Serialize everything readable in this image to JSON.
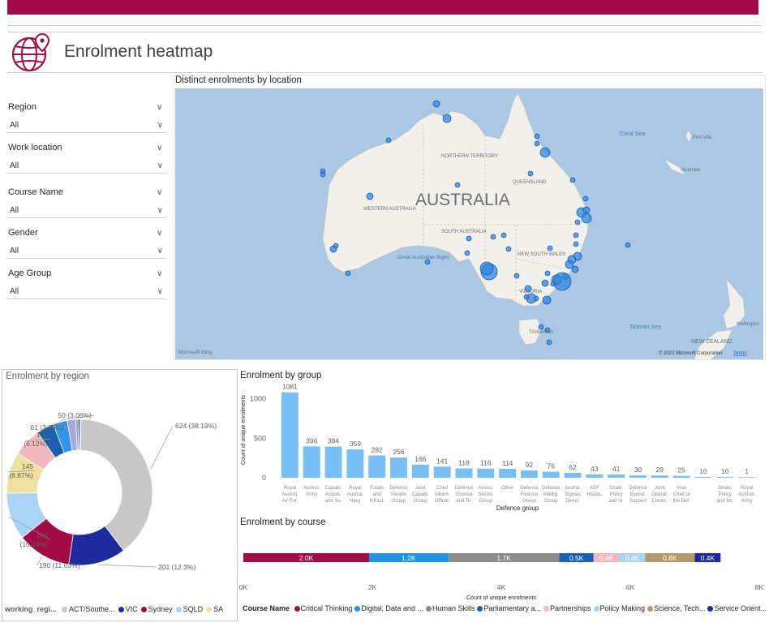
{
  "header": {
    "title": "Enrolment heatmap",
    "icon": "globe-pin-icon",
    "brand_color": "#a30b44"
  },
  "filters": [
    {
      "label": "Region",
      "value": "All"
    },
    {
      "label": "Work location",
      "value": "All"
    },
    {
      "label": "Course Name",
      "value": "All"
    },
    {
      "label": "Gender",
      "value": "All"
    },
    {
      "label": "Age Group",
      "value": "All"
    }
  ],
  "map": {
    "title": "Distinct enrolments by location",
    "labels": {
      "country": "AUSTRALIA",
      "nt": "NORTHERN TERRITORY",
      "qld": "QUEENSLAND",
      "wa": "WESTERN AUSTRALIA",
      "sa": "SOUTH AUSTRALIA",
      "nsw": "NEW SOUTH WALES",
      "vic": "VICTORIA",
      "tas": "TASMANIA",
      "bight": "Great Australian Bight",
      "coral": "Coral Sea",
      "tasman": "Tasman Sea",
      "nz": "NEW ZEALAND",
      "portvila": "Port-Vila",
      "noumea": "Noumea",
      "wellington": "Wellington"
    },
    "bing": "Microsoft Bing",
    "copyright": "© 2022 Microsoft Corporation",
    "terms": "Terms"
  },
  "donut": {
    "title": "Enrolment by region",
    "labels": {
      "act": "624 (38.19%)",
      "vic": "201 (12.3%)",
      "sydney": "190 (11.63%)",
      "sqld": "166 (10.16%)",
      "sa": "145 (8.87%)",
      "r6": "100 (6.12%)",
      "r7": "61 (3.73%)",
      "r8": "50 (3.06%)"
    },
    "legend_title": "working_regi...",
    "legend": [
      "ACT/Southe...",
      "VIC",
      "Sydney",
      "SQLD",
      "SA"
    ]
  },
  "bar_group": {
    "title": "Enrolment by group",
    "xlabel": "Defence group",
    "ylabel": "Count of unique enrolments"
  },
  "bar_course": {
    "title": "Enrolment by course",
    "xlabel": "Count of unique enrolments",
    "legend_title": "Course Name"
  },
  "chart_data": [
    {
      "type": "pie",
      "title": "Enrolment by region",
      "donut": true,
      "slices": [
        {
          "name": "ACT/Southe...",
          "value": 624,
          "pct": 38.19,
          "color": "#c8c8c8"
        },
        {
          "name": "VIC",
          "value": 201,
          "pct": 12.3,
          "color": "#1e2a9e"
        },
        {
          "name": "Sydney",
          "value": 190,
          "pct": 11.63,
          "color": "#a30b44"
        },
        {
          "name": "SQLD",
          "value": 166,
          "pct": 10.16,
          "color": "#a9d4f5"
        },
        {
          "name": "SA",
          "value": 145,
          "pct": 8.87,
          "color": "#efe29e"
        },
        {
          "name": "",
          "value": 100,
          "pct": 6.12,
          "color": "#f1b8c0"
        },
        {
          "name": "",
          "value": 61,
          "pct": 3.73,
          "color": "#1b5faf"
        },
        {
          "name": "",
          "value": 50,
          "pct": 3.06,
          "color": "#2f97ea"
        },
        {
          "name": "",
          "value": 30,
          "pct": 1.84,
          "color": "#a8a8e0"
        },
        {
          "name": "",
          "value": 8,
          "pct": 0.5,
          "color": "#a0a0a0"
        },
        {
          "name": "",
          "value": 6,
          "pct": 0.37,
          "color": "#1e2a9e"
        },
        {
          "name": "",
          "value": 4,
          "pct": 0.24,
          "color": "#2f97ea"
        }
      ],
      "legend_position": "bottom"
    },
    {
      "type": "bar",
      "title": "Enrolment by group",
      "xlabel": "Defence group",
      "ylabel": "Count of unique enrolments",
      "ylim": [
        0,
        1200
      ],
      "yticks": [
        0,
        500,
        1000
      ],
      "categories": [
        [
          "Royal",
          "Austral.",
          "Air For."
        ],
        [
          "Austral.",
          "Army"
        ],
        [
          "Capabi.",
          "Acquis.",
          "and Su."
        ],
        [
          "Royal",
          "Austral.",
          "Navy"
        ],
        [
          "Estate",
          "and",
          "Infrast."
        ],
        [
          "Defence",
          "People",
          "Group"
        ],
        [
          "Joint",
          "Capabi.",
          "Group"
        ],
        [
          "Chief",
          "Inform.",
          "Officer."
        ],
        [
          "Defence",
          "Science",
          "and Te."
        ],
        [
          "Associ.",
          "Secret.",
          "Group"
        ],
        [
          "Other"
        ],
        [
          "Defence",
          "Finance",
          "Group"
        ],
        [
          "Defence",
          "Intellig.",
          "Group"
        ],
        [
          "Austral.",
          "Signals",
          "Direct."
        ],
        [
          "ADF",
          "Heads."
        ],
        [
          "Strate.",
          "Policy",
          "and In."
        ],
        [
          "Defence",
          "Execut.",
          "Support"
        ],
        [
          "Joint",
          "Operat.",
          "Comm."
        ],
        [
          "Vice",
          "Chief of",
          "the Def."
        ],
        [
          ""
        ],
        [
          "Strate.",
          "Policy",
          "and Int."
        ],
        [
          "Royal",
          "Austral.",
          "Army"
        ]
      ],
      "values": [
        1081,
        396,
        394,
        359,
        282,
        256,
        166,
        141,
        118,
        116,
        114,
        92,
        76,
        62,
        43,
        41,
        30,
        29,
        25,
        10,
        10,
        1
      ],
      "color": "#77bff5"
    },
    {
      "type": "bar",
      "orientation": "horizontal-stacked",
      "title": "Enrolment by course",
      "xlabel": "Count of unique enrolments",
      "xlim": [
        0,
        8000
      ],
      "xticks": [
        "0K",
        "2K",
        "4K",
        "6K",
        "8K"
      ],
      "series": [
        {
          "name": "Critical Thinking",
          "value": 1950,
          "label": "2.0K",
          "color": "#a30b44"
        },
        {
          "name": "Digital, Data and ...",
          "value": 1230,
          "label": "1.2K",
          "color": "#1e93e8"
        },
        {
          "name": "Human Skills",
          "value": 1720,
          "label": "1.7K",
          "color": "#8c8c8c"
        },
        {
          "name": "Parliamentary a...",
          "value": 530,
          "label": "0.5K",
          "color": "#1b5faf"
        },
        {
          "name": "Partnerships",
          "value": 400,
          "label": "0.4K",
          "color": "#f1b8c0"
        },
        {
          "name": "Policy Making",
          "value": 400,
          "label": "0.4K",
          "color": "#a9d4f5"
        },
        {
          "name": "Science, Tech...",
          "value": 770,
          "label": "0.8K",
          "color": "#b49a6a"
        },
        {
          "name": "Service Orient...",
          "value": 400,
          "label": "0.4K",
          "color": "#1e2a9e"
        }
      ],
      "legend_position": "bottom"
    }
  ]
}
